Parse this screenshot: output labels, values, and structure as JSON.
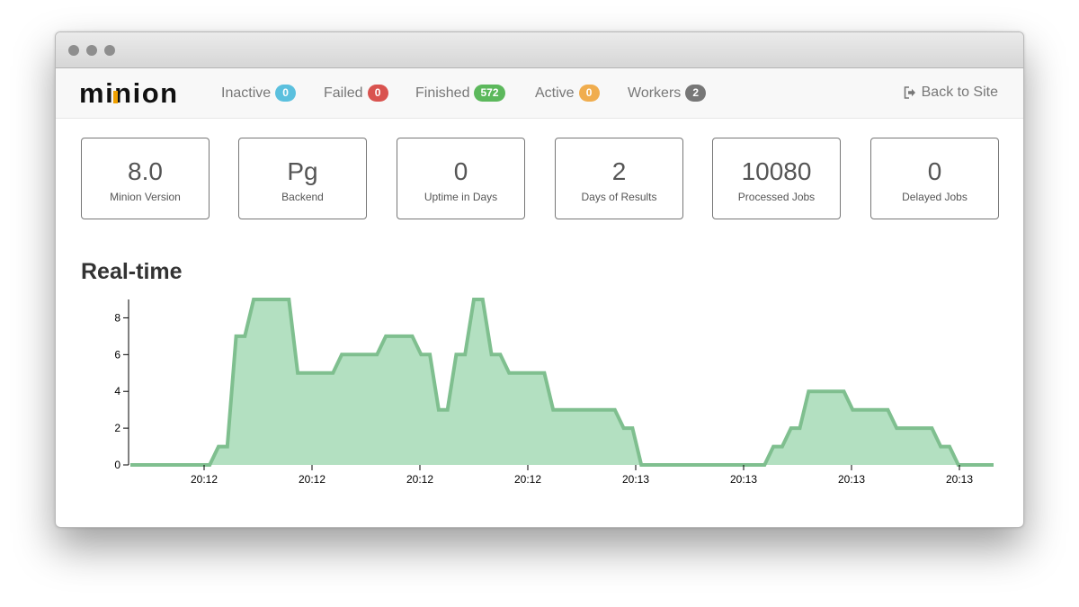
{
  "window": {
    "traffic_lights": [
      "close",
      "minimize",
      "zoom"
    ],
    "button_color": "#8e8e8e"
  },
  "brand": {
    "text": "minion",
    "accent_color": "#f0a000"
  },
  "nav": {
    "items": [
      {
        "label": "Inactive",
        "count": "0",
        "badge_color": "#5bc0de"
      },
      {
        "label": "Failed",
        "count": "0",
        "badge_color": "#d9534f"
      },
      {
        "label": "Finished",
        "count": "572",
        "badge_color": "#5cb85c"
      },
      {
        "label": "Active",
        "count": "0",
        "badge_color": "#f0ad4e"
      },
      {
        "label": "Workers",
        "count": "2",
        "badge_color": "#777777"
      }
    ],
    "back_link": {
      "label": "Back to Site",
      "icon": "sign-out-icon"
    }
  },
  "stats": [
    {
      "value": "8.0",
      "label": "Minion Version"
    },
    {
      "value": "Pg",
      "label": "Backend"
    },
    {
      "value": "0",
      "label": "Uptime in Days"
    },
    {
      "value": "2",
      "label": "Days of Results"
    },
    {
      "value": "10080",
      "label": "Processed Jobs"
    },
    {
      "value": "0",
      "label": "Delayed Jobs"
    }
  ],
  "realtime": {
    "title": "Real-time"
  },
  "chart_data": {
    "type": "area",
    "title": "",
    "xlabel": "",
    "ylabel": "",
    "ylim": [
      0,
      9
    ],
    "y_ticks": [
      0,
      2,
      4,
      6,
      8
    ],
    "x_tick_labels": [
      "20:12",
      "20:12",
      "20:12",
      "20:12",
      "20:13",
      "20:13",
      "20:13",
      "20:13"
    ],
    "grid": false,
    "fill_color": "#b3e0c1",
    "line_color": "#7fbf8f",
    "series": [
      {
        "values": [
          0,
          0,
          0,
          0,
          0,
          0,
          0,
          0,
          0,
          0,
          1,
          1,
          7,
          7,
          9,
          9,
          9,
          9,
          9,
          5,
          5,
          5,
          5,
          5,
          6,
          6,
          6,
          6,
          6,
          7,
          7,
          7,
          7,
          6,
          6,
          3,
          3,
          6,
          6,
          9,
          9,
          6,
          6,
          5,
          5,
          5,
          5,
          5,
          3,
          3,
          3,
          3,
          3,
          3,
          3,
          3,
          2,
          2,
          0,
          0,
          0,
          0,
          0,
          0,
          0,
          0,
          0,
          0,
          0,
          0,
          0,
          0,
          0,
          1,
          1,
          2,
          2,
          4,
          4,
          4,
          4,
          4,
          3,
          3,
          3,
          3,
          3,
          2,
          2,
          2,
          2,
          2,
          1,
          1,
          0,
          0,
          0,
          0,
          0
        ]
      }
    ]
  }
}
